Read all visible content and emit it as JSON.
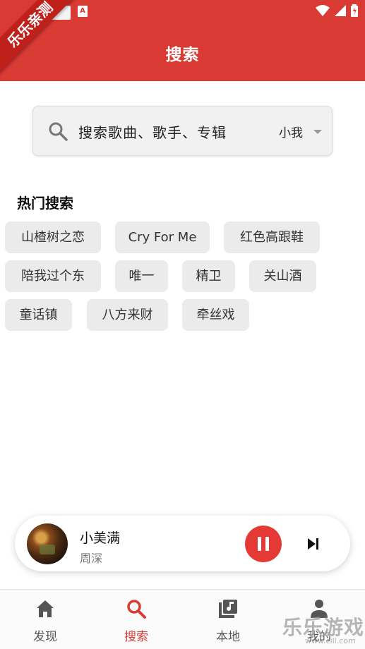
{
  "header": {
    "title": "搜索"
  },
  "ribbon_text": "乐乐亲测",
  "search": {
    "placeholder": "搜索歌曲、歌手、专辑",
    "scope": "小我"
  },
  "hot": {
    "title": "热门搜索",
    "chips": [
      "山楂树之恋",
      "Cry For Me",
      "红色高跟鞋",
      "陪我过个东",
      "唯一",
      "精卫",
      "关山酒",
      "童话镇",
      "八方来财",
      "牵丝戏"
    ]
  },
  "player": {
    "title": "小美满",
    "artist": "周深",
    "state": "playing"
  },
  "nav": {
    "items": [
      {
        "label": "发现",
        "icon": "home-icon",
        "active": false
      },
      {
        "label": "搜索",
        "icon": "search-icon",
        "active": true
      },
      {
        "label": "本地",
        "icon": "music-library-icon",
        "active": false
      },
      {
        "label": "我的",
        "icon": "person-icon",
        "active": false
      }
    ]
  },
  "watermark": {
    "text": "乐乐游戏",
    "url": "www.cill.com"
  },
  "colors": {
    "accent": "#d93a34",
    "play": "#e53935"
  }
}
